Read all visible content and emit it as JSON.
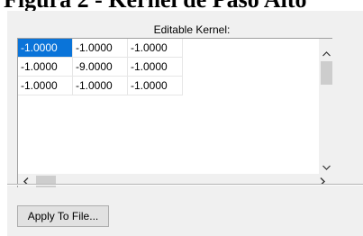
{
  "doc_heading": "Figura 2 - Kernel de Paso Alto",
  "panel": {
    "title": "Editable Kernel:"
  },
  "kernel": {
    "rows": [
      [
        "-1.0000",
        "-1.0000",
        "-1.0000"
      ],
      [
        "-1.0000",
        "-9.0000",
        "-1.0000"
      ],
      [
        "-1.0000",
        "-1.0000",
        "-1.0000"
      ]
    ],
    "selected_cell": [
      0,
      0
    ]
  },
  "scrollbars": {
    "up_icon": "▲",
    "down_icon": "▼",
    "left_icon": "‹",
    "right_icon": "›"
  },
  "buttons": {
    "apply_label": "Apply To File..."
  },
  "colors": {
    "selection": "#0a74d9",
    "dialog_background": "#f0f0f0"
  }
}
